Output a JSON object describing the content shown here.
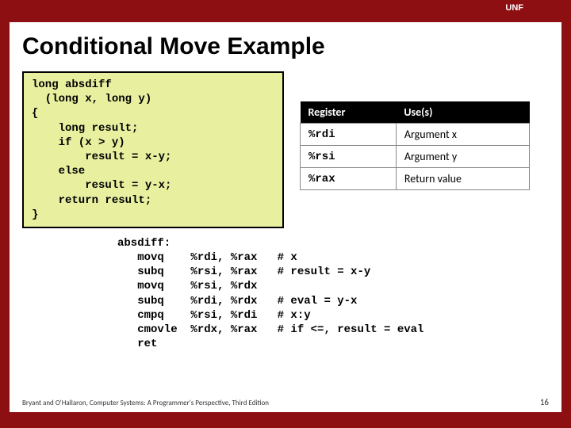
{
  "topbar": {
    "label": "UNF"
  },
  "title": "Conditional Move Example",
  "code": "long absdiff\n  (long x, long y)\n{\n    long result;\n    if (x > y)\n        result = x-y;\n    else\n        result = y-x;\n    return result;\n}",
  "table": {
    "headers": [
      "Register",
      "Use(s)"
    ],
    "rows": [
      {
        "reg": "%rdi",
        "use": "Argument x"
      },
      {
        "reg": "%rsi",
        "use": "Argument y"
      },
      {
        "reg": "%rax",
        "use": "Return value"
      }
    ]
  },
  "asm": "absdiff:\n   movq    %rdi, %rax   # x\n   subq    %rsi, %rax   # result = x-y\n   movq    %rsi, %rdx\n   subq    %rdi, %rdx   # eval = y-x\n   cmpq    %rsi, %rdi   # x:y\n   cmovle  %rdx, %rax   # if <=, result = eval\n   ret",
  "footer": "Bryant and O'Hallaron, Computer Systems: A Programmer's Perspective, Third Edition",
  "pagenum": "16"
}
